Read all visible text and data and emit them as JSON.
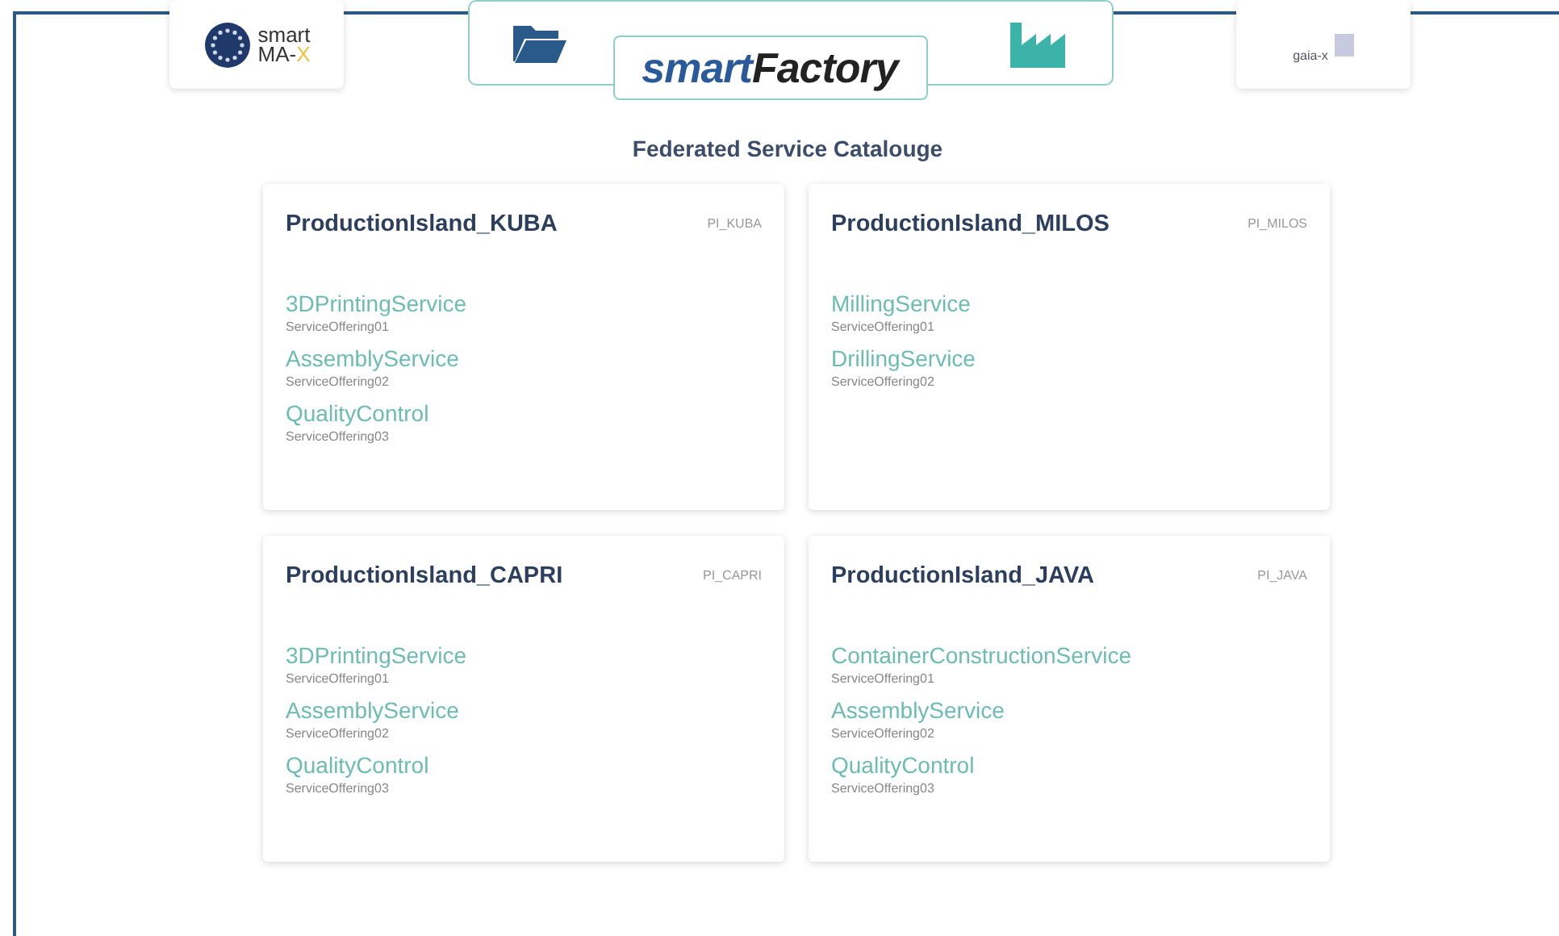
{
  "header": {
    "left_logo": {
      "line_1": "smart",
      "line_2": "MA-",
      "line_2_accent": "X"
    },
    "center_logo": {
      "part_1": "smart",
      "part_2": "Factory"
    },
    "right_logo": {
      "text": "gaia-x"
    }
  },
  "title": "Federated Service Catalouge",
  "islands": [
    {
      "name": "ProductionIsland_KUBA",
      "code": "PI_KUBA",
      "services": [
        {
          "name": "3DPrintingService",
          "offering": "ServiceOffering01"
        },
        {
          "name": "AssemblyService",
          "offering": "ServiceOffering02"
        },
        {
          "name": "QualityControl",
          "offering": "ServiceOffering03"
        }
      ]
    },
    {
      "name": "ProductionIsland_MILOS",
      "code": "PI_MILOS",
      "services": [
        {
          "name": "MillingService",
          "offering": "ServiceOffering01"
        },
        {
          "name": "DrillingService",
          "offering": "ServiceOffering02"
        }
      ]
    },
    {
      "name": "ProductionIsland_CAPRI",
      "code": "PI_CAPRI",
      "services": [
        {
          "name": "3DPrintingService",
          "offering": "ServiceOffering01"
        },
        {
          "name": "AssemblyService",
          "offering": "ServiceOffering02"
        },
        {
          "name": "QualityControl",
          "offering": "ServiceOffering03"
        }
      ]
    },
    {
      "name": "ProductionIsland_JAVA",
      "code": "PI_JAVA",
      "services": [
        {
          "name": "ContainerConstructionService",
          "offering": "ServiceOffering01"
        },
        {
          "name": "AssemblyService",
          "offering": "ServiceOffering02"
        },
        {
          "name": "QualityControl",
          "offering": "ServiceOffering03"
        }
      ]
    }
  ]
}
